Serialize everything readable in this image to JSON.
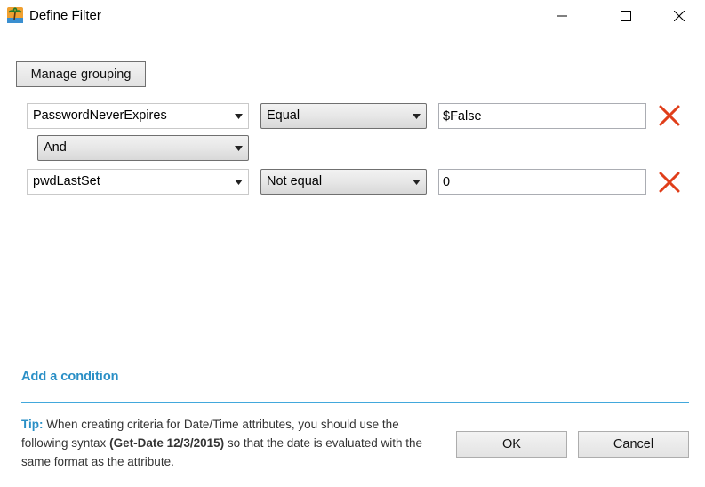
{
  "window": {
    "title": "Define Filter",
    "icons": {
      "app": "palm-tree-icon",
      "minimize": "minimize-icon",
      "maximize": "maximize-icon",
      "close": "close-icon"
    }
  },
  "toolbar": {
    "manage_grouping_label": "Manage grouping"
  },
  "conditions": [
    {
      "attribute": "PasswordNeverExpires",
      "operator": "Equal",
      "value": "$False"
    },
    {
      "attribute": "pwdLastSet",
      "operator": "Not equal",
      "value": "0"
    }
  ],
  "logic_operator": "And",
  "add_condition_label": "Add a condition",
  "tip": {
    "label": "Tip:",
    "text_before": "When creating criteria for Date/Time attributes, you should use the following syntax",
    "code": "(Get-Date 12/3/2015)",
    "text_after": "so that the date is evaluated with the same format as the attribute."
  },
  "buttons": {
    "ok": "OK",
    "cancel": "Cancel"
  },
  "colors": {
    "accent": "#2a8fc6",
    "separator": "#42a8dc",
    "delete": "#e03e1a"
  }
}
